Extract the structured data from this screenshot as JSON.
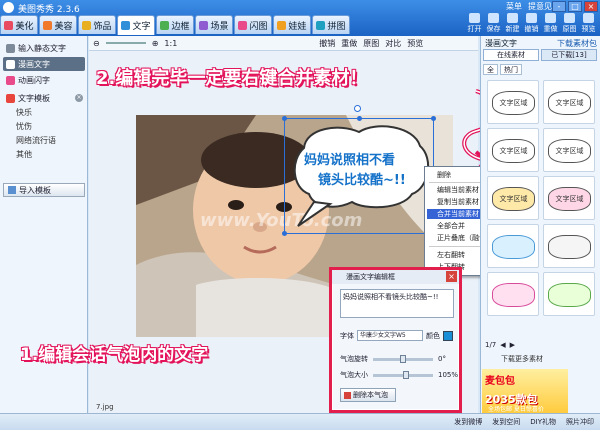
{
  "window": {
    "title": "美图秀秀 2.3.6",
    "menu_labels": [
      "菜单",
      "提意见"
    ],
    "controls": [
      "-",
      "□",
      "×"
    ]
  },
  "tabs": [
    {
      "label": "美化",
      "color": "#e84a5f"
    },
    {
      "label": "美容",
      "color": "#f07a2a"
    },
    {
      "label": "饰品",
      "color": "#e8b020"
    },
    {
      "label": "文字",
      "color": "#2f8fd8"
    },
    {
      "label": "边框",
      "color": "#4caf50"
    },
    {
      "label": "场景",
      "color": "#8e5bd0"
    },
    {
      "label": "闪图",
      "color": "#e84a8a"
    },
    {
      "label": "娃娃",
      "color": "#f0a020"
    },
    {
      "label": "拼图",
      "color": "#20a0c0"
    }
  ],
  "toolbar_right": [
    "打开",
    "保存",
    "新建",
    "撤销",
    "重做",
    "原图",
    "预览"
  ],
  "left_panel": {
    "items": [
      "输入静态文字",
      "漫画文字",
      "动画闪字",
      "文字模板"
    ],
    "template_sub": [
      "快乐",
      "忧伤",
      "网络流行语",
      "其他"
    ],
    "import_label": "导入模板"
  },
  "canvas_toolbar": [
    "1:1",
    "撤销",
    "重做",
    "原图",
    "对比",
    "预览"
  ],
  "canvas": {
    "filename": "7.jpg",
    "watermark": "www.YouTo.com"
  },
  "bubble": {
    "line1": "妈妈说照相不看",
    "line2": "镜头比较酷~!!"
  },
  "annotations": {
    "top": "2.编辑完毕一定要右键合并素材！",
    "bottom": "1.编辑会话气泡内的文字"
  },
  "context_menu": {
    "items": [
      "删除",
      "编辑当前素材",
      "复制当前素材",
      "合并当前素材",
      "全部合并",
      "正片叠底（融合）",
      "左右翻转",
      "上下翻转"
    ],
    "highlighted": "合并当前素材"
  },
  "dialog": {
    "title": "漫画文字编辑框",
    "text": "妈妈说照相不看镜头比较酷~!!",
    "font_label": "字体",
    "font_value": "华康少女文字W5",
    "color_label": "颜色",
    "color": "#1a8fd8",
    "rotate_label": "气泡旋转",
    "rotate_value": "0°",
    "size_label": "气泡大小",
    "size_value": "105%",
    "rotate_fraction": 0.5,
    "size_fraction": 0.55,
    "delete_label": "删除本气泡"
  },
  "right_panel": {
    "title": "漫画文字",
    "download": "下载素材包",
    "tabs": [
      "在线素材",
      "已下载[13]"
    ],
    "filter": [
      "全",
      "热门"
    ],
    "tile_labels": [
      "文字区域",
      "文字区域",
      "文字区域",
      "文字区域",
      "文字区域",
      "文字区域",
      "",
      "",
      "",
      ""
    ],
    "pager": "1/7",
    "more": "下载更多素材",
    "ad_line1": "麦包包",
    "ad_line2": "2035款包",
    "ad_line3": "全场包邮 夏日惊喜价"
  },
  "status_bar": [
    "发到微博",
    "发到空间",
    "DIY礼物",
    "照片冲印"
  ]
}
